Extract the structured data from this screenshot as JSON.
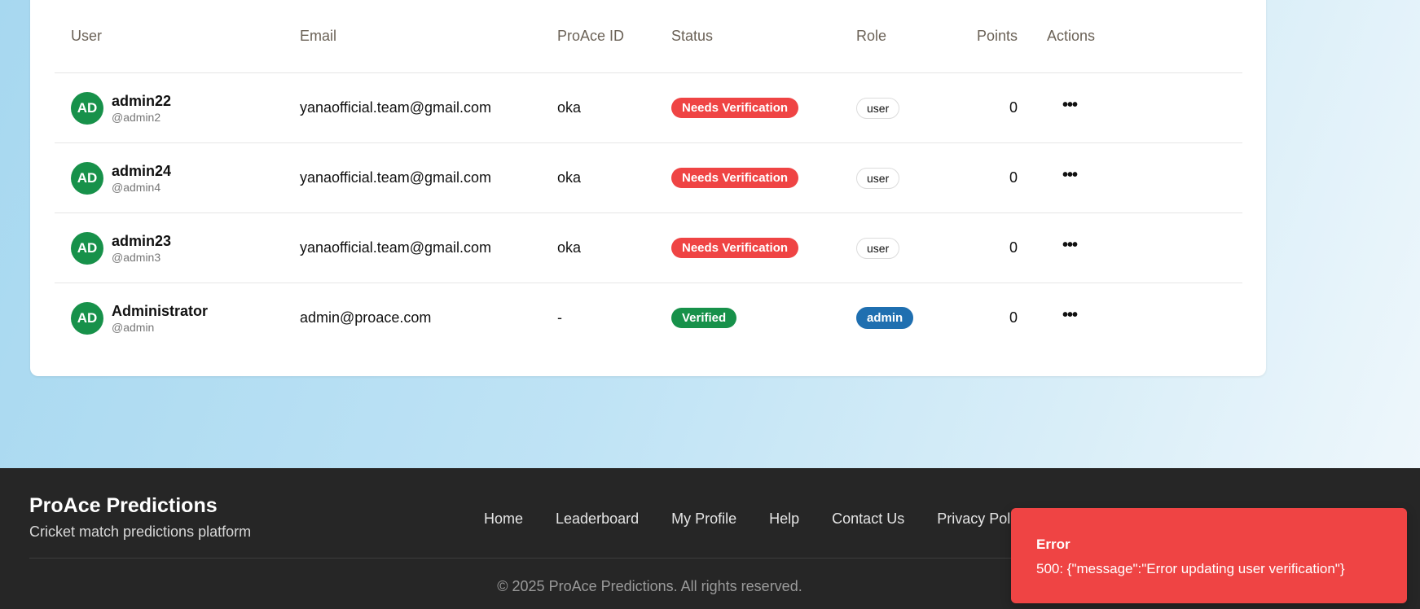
{
  "table": {
    "headers": {
      "user": "User",
      "email": "Email",
      "proace_id": "ProAce ID",
      "status": "Status",
      "role": "Role",
      "points": "Points",
      "actions": "Actions"
    },
    "rows": [
      {
        "initials": "AD",
        "name": "admin22",
        "handle": "@admin2",
        "email": "yanaofficial.team@gmail.com",
        "proace_id": "oka",
        "status": "Needs Verification",
        "role": "user",
        "points": "0"
      },
      {
        "initials": "AD",
        "name": "admin24",
        "handle": "@admin4",
        "email": "yanaofficial.team@gmail.com",
        "proace_id": "oka",
        "status": "Needs Verification",
        "role": "user",
        "points": "0"
      },
      {
        "initials": "AD",
        "name": "admin23",
        "handle": "@admin3",
        "email": "yanaofficial.team@gmail.com",
        "proace_id": "oka",
        "status": "Needs Verification",
        "role": "user",
        "points": "0"
      },
      {
        "initials": "AD",
        "name": "Administrator",
        "handle": "@admin",
        "email": "admin@proace.com",
        "proace_id": "-",
        "status": "Verified",
        "role": "admin",
        "points": "0"
      }
    ],
    "actions_icon": "more-horizontal-icon"
  },
  "footer": {
    "brand": "ProAce Predictions",
    "tagline": "Cricket match predictions platform",
    "nav": [
      "Home",
      "Leaderboard",
      "My Profile",
      "Help",
      "Contact Us",
      "Privacy Policy"
    ],
    "copyright": "© 2025 ProAce Predictions. All rights reserved."
  },
  "toast": {
    "title": "Error",
    "message": "500: {\"message\":\"Error updating user verification\"}"
  },
  "colors": {
    "needs_verification": "#ef4444",
    "verified": "#17914a",
    "admin_role": "#1f6fb0",
    "avatar": "#17914a",
    "footer_bg": "#262626",
    "toast_bg": "#ef4444"
  }
}
